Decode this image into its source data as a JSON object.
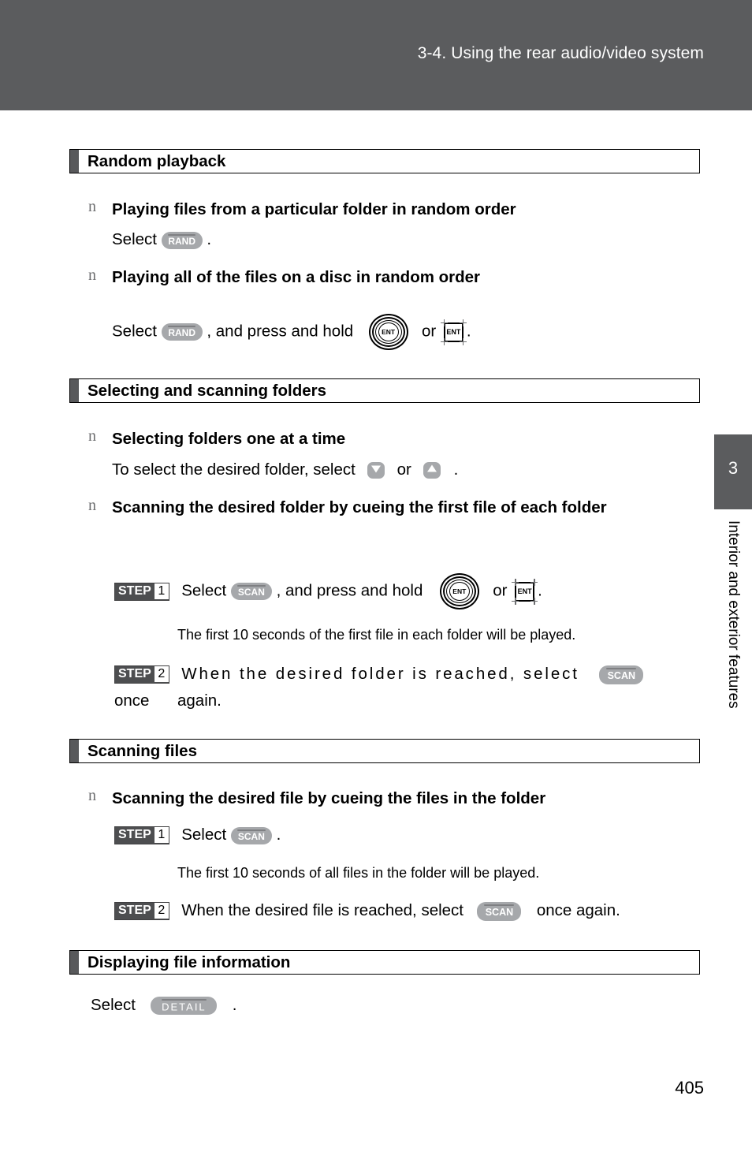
{
  "page": {
    "header_title": "3-4. Using the rear audio/video system",
    "page_number": "405",
    "side_tab": {
      "chapter_number": "3",
      "chapter_title": "Interior and exterior features"
    }
  },
  "icons": {
    "rand": "RAND",
    "scan": "SCAN",
    "detail": "DETAIL",
    "ent": "ENT",
    "arrow_down": "arrow-down-key",
    "arrow_up": "arrow-up-key"
  },
  "sections": [
    {
      "id": "random-playback",
      "title": "Random playback",
      "items": [
        {
          "bullet": "n",
          "heading": "Playing files from a particular folder in random order",
          "line_prefix": "Select",
          "line_suffix": "."
        },
        {
          "bullet": "n",
          "heading": "Playing all of the files on a disc in random order",
          "line_prefix": "Select",
          "line_mid": ", and press and hold",
          "line_or": "or",
          "line_suffix": "."
        }
      ]
    },
    {
      "id": "selecting-and-scanning-folders",
      "title": "Selecting and scanning folders",
      "items": [
        {
          "bullet": "n",
          "heading": "Selecting folders one at a time",
          "line_prefix": "To select the desired folder, select",
          "line_or": "or",
          "line_suffix": "."
        },
        {
          "bullet": "n",
          "heading": "Scanning the desired folder by cueing the first file of each folder",
          "steps": [
            {
              "badge_word": "STEP",
              "badge_num": "1",
              "text_prefix": "Select",
              "text_mid": ", and press and hold",
              "text_or": "or",
              "text_suffix": ".",
              "note": "The first 10 seconds of the first file in each folder will be played."
            },
            {
              "badge_word": "STEP",
              "badge_num": "2",
              "text_prefix": "When the desired folder is reached, select",
              "text_suffix": "once",
              "text_wrap": "again."
            }
          ]
        }
      ]
    },
    {
      "id": "scanning-files",
      "title": "Scanning files",
      "items": [
        {
          "bullet": "n",
          "heading": "Scanning the desired file by cueing the files in the folder",
          "steps": [
            {
              "badge_word": "STEP",
              "badge_num": "1",
              "text_prefix": "Select",
              "text_suffix": ".",
              "note": "The first 10 seconds of all files in the folder will be played."
            },
            {
              "badge_word": "STEP",
              "badge_num": "2",
              "text_prefix": "When the desired file is reached, select",
              "text_suffix": "once again."
            }
          ]
        }
      ]
    },
    {
      "id": "displaying-file-information",
      "title": "Displaying file information",
      "items": [
        {
          "line_prefix": "Select",
          "line_suffix": "."
        }
      ]
    }
  ]
}
